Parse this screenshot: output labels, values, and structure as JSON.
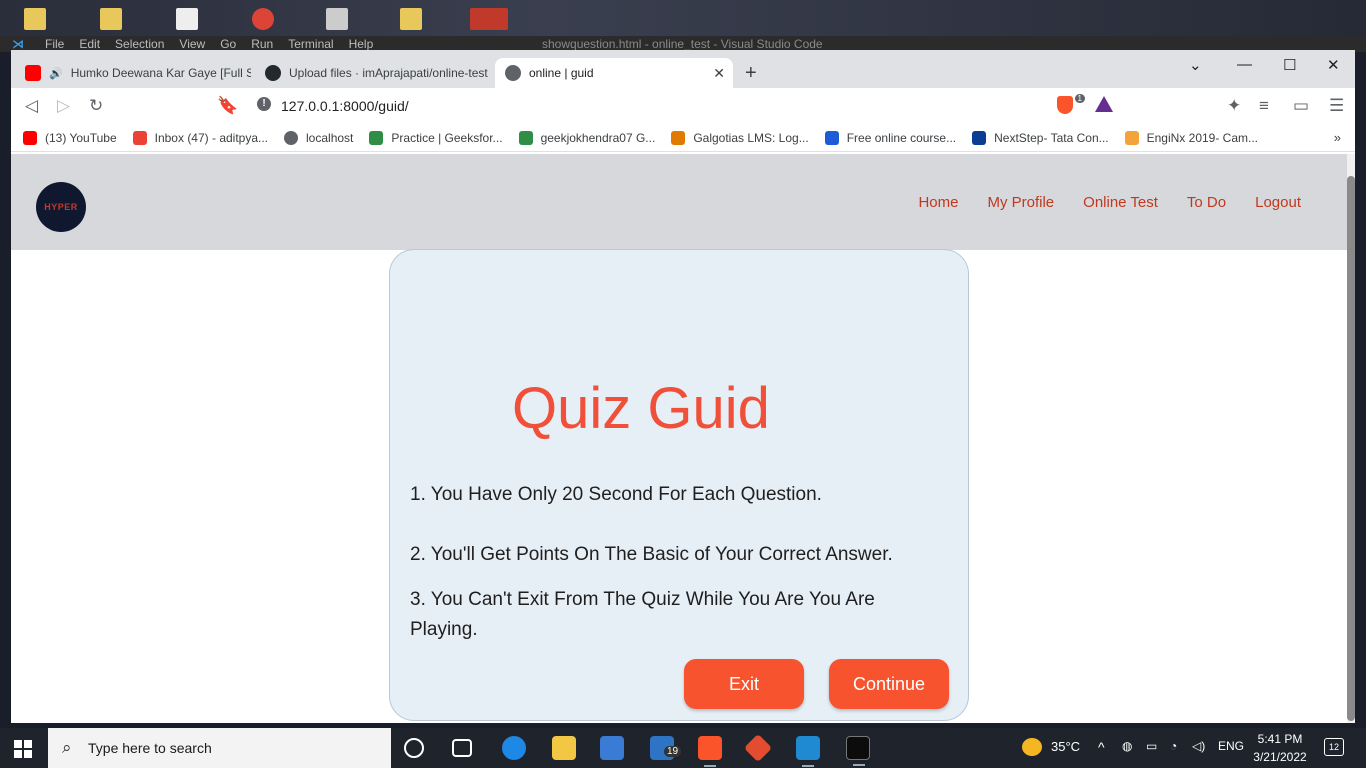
{
  "vscode": {
    "menu": [
      "File",
      "Edit",
      "Selection",
      "View",
      "Go",
      "Run",
      "Terminal",
      "Help"
    ],
    "title": "showquestion.html - online_test - Visual Studio Code"
  },
  "browser": {
    "tabs": [
      {
        "label": "Humko Deewana Kar Gaye [Full So",
        "icon": "youtube-icon"
      },
      {
        "label": "Upload files · imAprajapati/online-test",
        "icon": "github-icon"
      },
      {
        "label": "online | guid",
        "icon": "globe-icon",
        "active": true
      }
    ],
    "url": "127.0.0.1:8000/guid/",
    "shield_count": "1",
    "bookmarks": [
      {
        "label": "(13) YouTube",
        "color": "#ff0000"
      },
      {
        "label": "Inbox (47) - aditpya...",
        "color": "#ea4335"
      },
      {
        "label": "localhost",
        "color": "#5f6368"
      },
      {
        "label": "Practice | Geeksfor...",
        "color": "#2f8d46"
      },
      {
        "label": "geekjokhendra07 G...",
        "color": "#2f8d46"
      },
      {
        "label": "Galgotias LMS: Log...",
        "color": "#e07a00"
      },
      {
        "label": "Free online course...",
        "color": "#1f5bd6"
      },
      {
        "label": "NextStep- Tata Con...",
        "color": "#0b3d91"
      },
      {
        "label": "EngiNx 2019- Cam...",
        "color": "#f2a33a"
      }
    ]
  },
  "page": {
    "logo_text": "HYPER",
    "nav": [
      "Home",
      "My Profile",
      "Online Test",
      "To Do",
      "Logout"
    ],
    "title": "Quiz Guid",
    "rules": [
      "1. You Have Only 20 Second For Each Question.",
      "2. You'll Get Points On The Basic of Your Correct Answer.",
      "3. You Can't Exit From The Quiz While You Are You Are Playing."
    ],
    "exit_label": "Exit",
    "continue_label": "Continue",
    "accent": "#f7532f"
  },
  "taskbar": {
    "search_placeholder": "Type here to search",
    "mail_badge": "19",
    "temperature": "35°C",
    "language": "ENG",
    "time": "5:41 PM",
    "date": "3/21/2022",
    "notifications": "12"
  }
}
